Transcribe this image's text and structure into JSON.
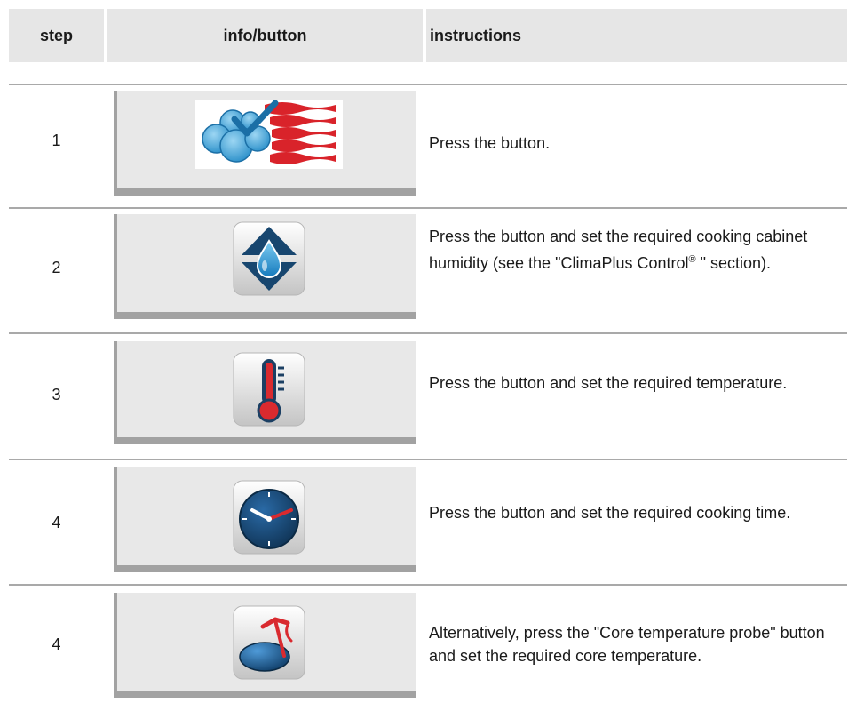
{
  "header": {
    "step": "step",
    "info": "info/button",
    "instructions": "instructions"
  },
  "rows": [
    {
      "step": "1",
      "icon": "steam-hot-air-combination-icon",
      "text": "Press the button."
    },
    {
      "step": "2",
      "icon": "humidity-icon",
      "text_before_sup": "Press the button and set the required cooking cabinet humidity (see the \"ClimaPlus Control",
      "sup": "®",
      "text_after_sup": " \" section)."
    },
    {
      "step": "3",
      "icon": "thermometer-icon",
      "text": "Press the button and set the required temperature."
    },
    {
      "step": "4",
      "icon": "clock-icon",
      "text": "Press the button and set the required cooking time."
    },
    {
      "step": "4",
      "icon": "core-temperature-probe-icon",
      "text": "Alternatively, press the \"Core temperature probe\" button and set the required core temperature."
    }
  ],
  "colors": {
    "header_bg": "#e6e6e6",
    "panel_bg": "#e8e8e8",
    "panel_border": "#a2a2a2",
    "icon_blue": "#1d5f9c",
    "icon_red": "#d2252b"
  }
}
